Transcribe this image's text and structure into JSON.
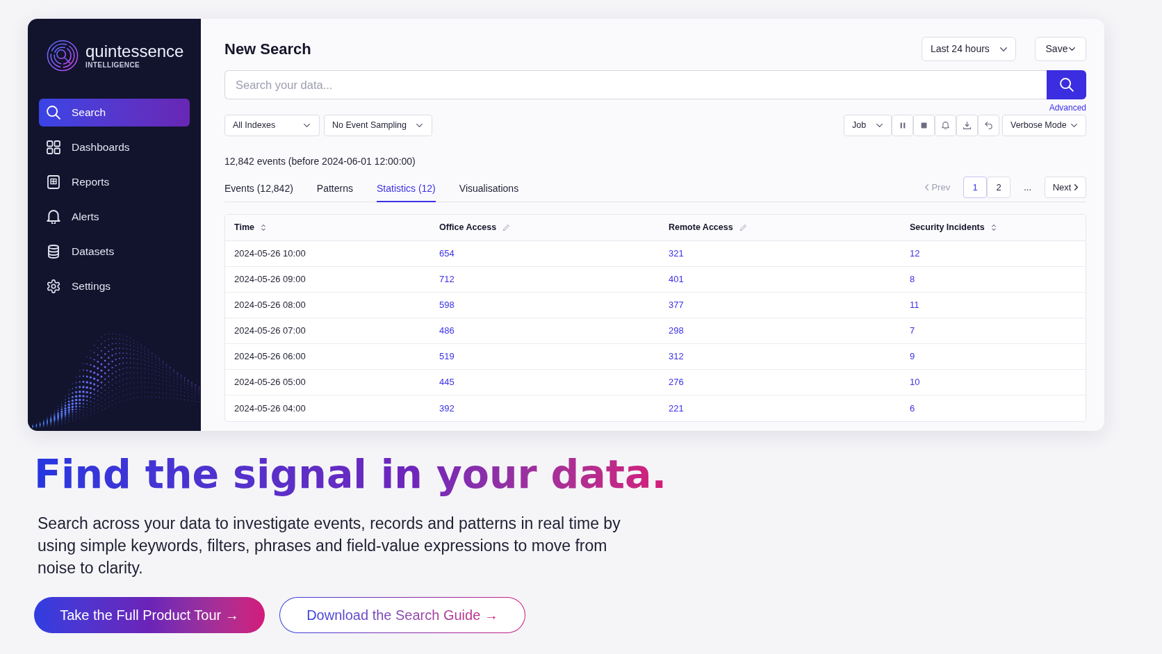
{
  "sidebar": {
    "brand": {
      "name": "quintessence",
      "tagline": "INTELLIGENCE"
    },
    "items": [
      {
        "label": "Search",
        "selected": true
      },
      {
        "label": "Dashboards",
        "selected": false
      },
      {
        "label": "Reports",
        "selected": false
      },
      {
        "label": "Alerts",
        "selected": false
      },
      {
        "label": "Datasets",
        "selected": false
      },
      {
        "label": "Settings",
        "selected": false
      }
    ]
  },
  "header": {
    "title": "New Search",
    "time_range": "Last 24 hours",
    "save": "Save"
  },
  "search": {
    "placeholder": "Search your data...",
    "advanced": "Advanced"
  },
  "filters": [
    "All Indexes",
    "No Event Sampling"
  ],
  "toolbar": {
    "job": "Job",
    "mode": "Verbose Mode"
  },
  "summary": "12,842 events (before 2024-06-01 12:00:00)",
  "tabs": [
    {
      "label": "Events (12,842)",
      "selected": false
    },
    {
      "label": "Patterns",
      "selected": false
    },
    {
      "label": "Statistics (12)",
      "selected": true
    },
    {
      "label": "Visualisations",
      "selected": false
    }
  ],
  "pagination": {
    "prev": {
      "label": "Prev",
      "disabled": true
    },
    "pages": [
      {
        "label": "1",
        "selected": true
      },
      {
        "label": "2",
        "selected": false
      }
    ],
    "ellipsis": "...",
    "next": {
      "label": "Next"
    }
  },
  "table": {
    "columns": [
      {
        "label": "Time",
        "kind": "sortable",
        "links": false
      },
      {
        "label": "Office Access",
        "kind": "editable",
        "links": true
      },
      {
        "label": "Remote Access",
        "kind": "editable",
        "links": true
      },
      {
        "label": "Security Incidents",
        "kind": "sortable",
        "links": true
      }
    ],
    "rows": [
      [
        "2024-05-26 10:00",
        "654",
        "321",
        "12"
      ],
      [
        "2024-05-26 09:00",
        "712",
        "401",
        "8"
      ],
      [
        "2024-05-26 08:00",
        "598",
        "377",
        "11"
      ],
      [
        "2024-05-26 07:00",
        "486",
        "298",
        "7"
      ],
      [
        "2024-05-26 06:00",
        "519",
        "312",
        "9"
      ],
      [
        "2024-05-26 05:00",
        "445",
        "276",
        "10"
      ],
      [
        "2024-05-26 04:00",
        "392",
        "221",
        "6"
      ]
    ]
  },
  "hero": {
    "title": "Find the signal in your data.",
    "description": "Search across your data to investigate events, records and patterns in real time by using simple keywords, filters, phrases and field-value expressions to move from noise to clarity.",
    "buttons": [
      {
        "label": "Take the Full Product Tour →",
        "kind": "primary"
      },
      {
        "label": "Download the Search Guide →",
        "kind": "secondary"
      }
    ]
  }
}
